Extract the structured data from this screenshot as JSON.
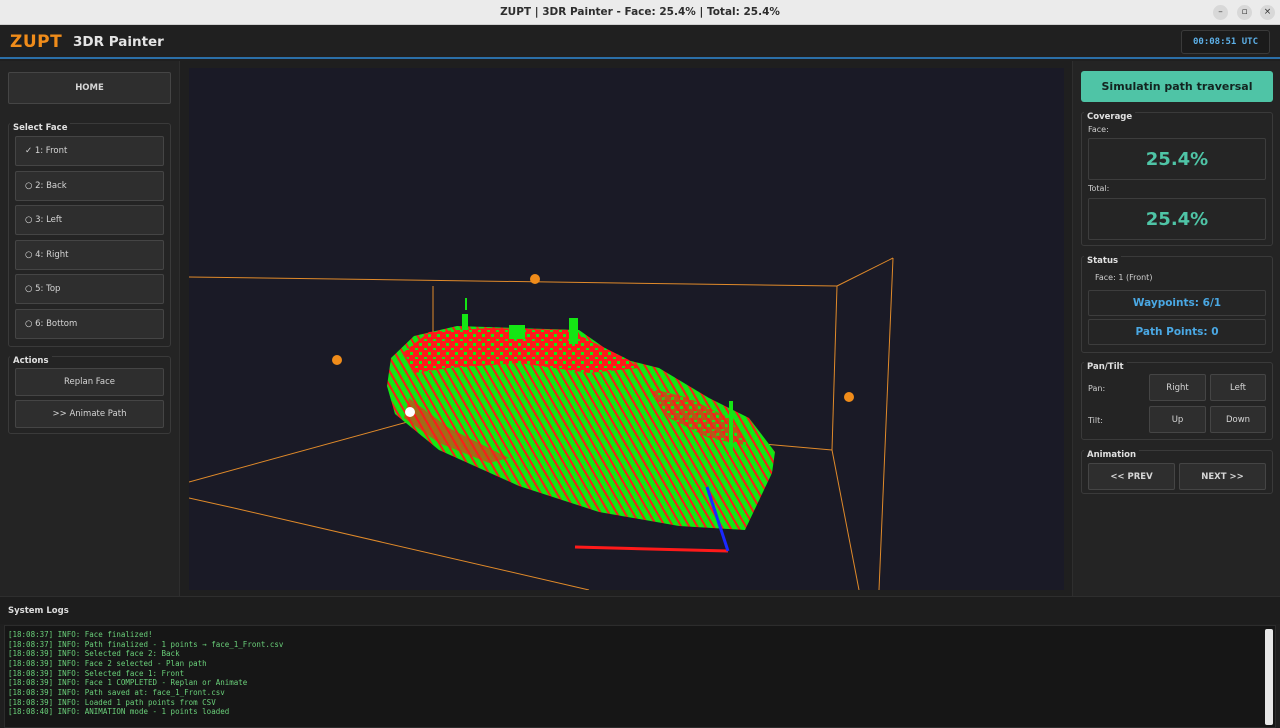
{
  "window": {
    "title": "ZUPT | 3DR Painter - Face: 25.4% | Total: 25.4%",
    "controls": {
      "minimize": "–",
      "restore": "▫",
      "close": "×"
    }
  },
  "header": {
    "logo": "ZUPT",
    "title": "3DR Painter",
    "clock": "00:08:51 UTC"
  },
  "left": {
    "home_label": "HOME",
    "select_face_title": "Select Face",
    "faces": [
      "✓ 1: Front",
      "○ 2: Back",
      "○ 3: Left",
      "○ 4: Right",
      "○ 5: Top",
      "○ 6: Bottom"
    ],
    "actions_title": "Actions",
    "replan_label": "Replan Face",
    "animate_label": ">> Animate Path"
  },
  "right": {
    "primary_label": "Simulatin path traversal",
    "coverage_title": "Coverage",
    "face_label": "Face:",
    "face_value": "25.4%",
    "total_label": "Total:",
    "total_value": "25.4%",
    "status_title": "Status",
    "status_face": "Face: 1 (Front)",
    "waypoints": "Waypoints: 6/1",
    "path_points": "Path Points: 0",
    "pantilt_title": "Pan/Tilt",
    "pan_label": "Pan:",
    "tilt_label": "Tilt:",
    "right_label": "Right",
    "left_label": "Left",
    "up_label": "Up",
    "down_label": "Down",
    "animation_title": "Animation",
    "prev_label": "<< PREV",
    "next_label": "NEXT >>"
  },
  "logs": {
    "title": "System Logs",
    "lines": [
      "[18:08:37] INFO: Face finalized!",
      "[18:08:37] INFO: Path finalized - 1 points → face_1_Front.csv",
      "[18:08:39] INFO: Selected face 2: Back",
      "[18:08:39] INFO: Face 2 selected - Plan path",
      "[18:08:39] INFO: Selected face 1: Front",
      "[18:08:39] INFO: Face 1 COMPLETED - Replan or Animate",
      "[18:08:39] INFO: Path saved at: face_1_Front.csv",
      "[18:08:39] INFO: Loaded 1 path points from CSV",
      "[18:08:40] INFO: ANIMATION mode - 1 points loaded"
    ]
  },
  "colors": {
    "accent": "#4fc4a6",
    "brand": "#f08c1a",
    "info_blue": "#4aa8e4",
    "log_green": "#6ad07a",
    "painted": "#ff1a1a",
    "unpainted": "#14e614",
    "bbox": "#e08a2a"
  }
}
